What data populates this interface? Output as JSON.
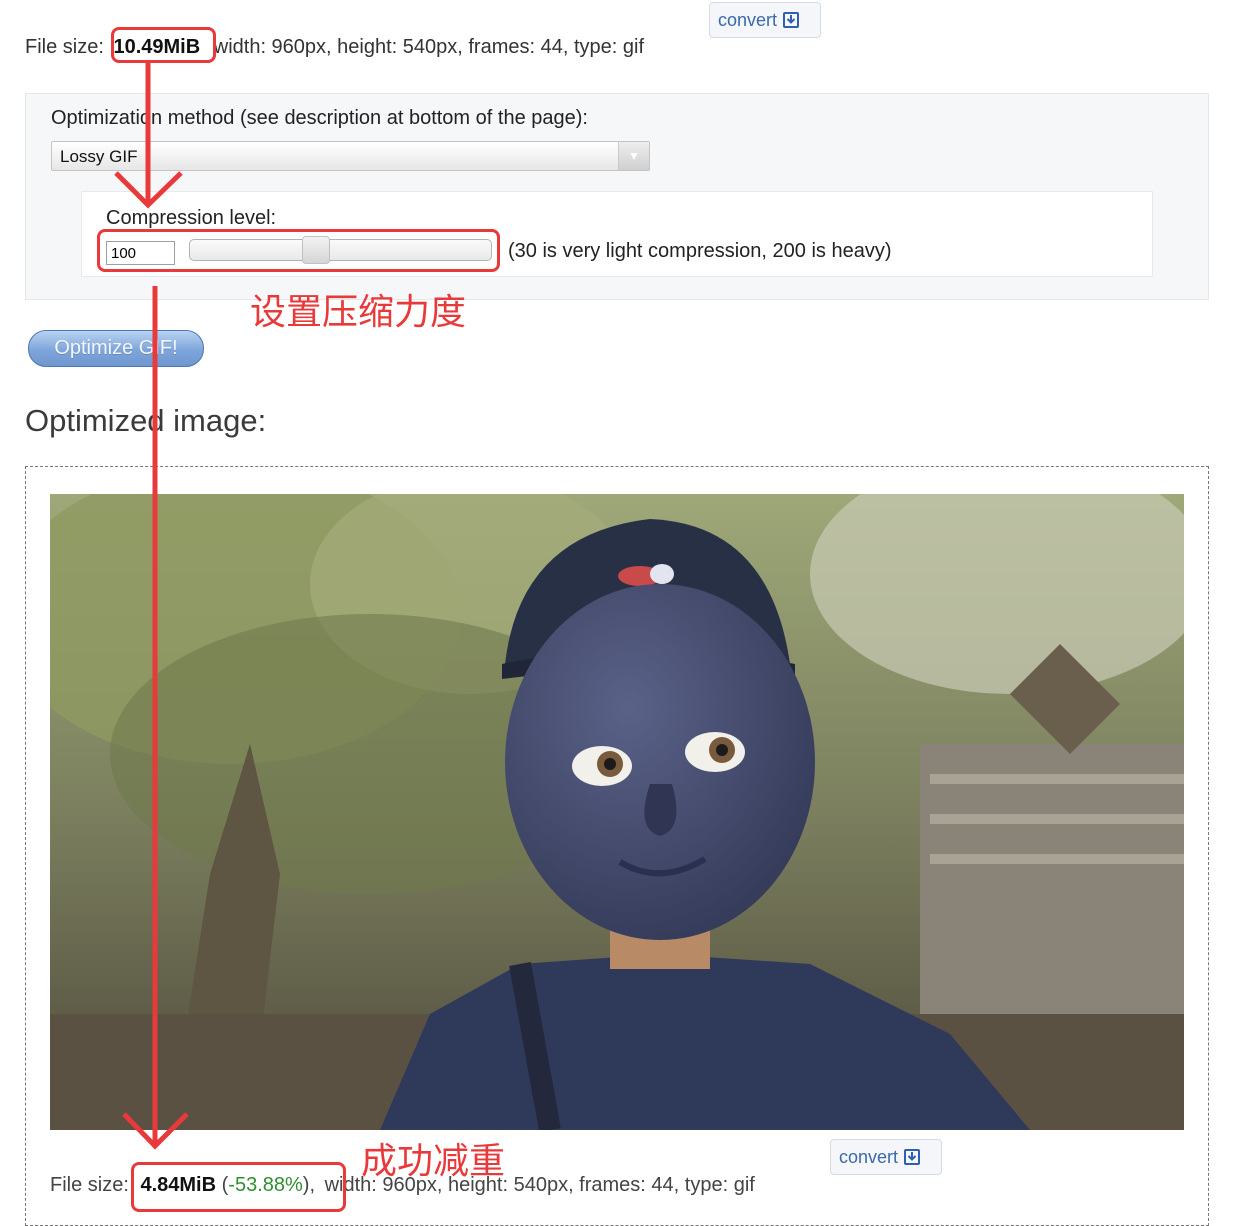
{
  "original": {
    "file_size_label": "File size:",
    "file_size_value": "10.49MiB",
    "details": "width: 960px, height: 540px, frames: 44, type: gif",
    "convert_label": "convert"
  },
  "options": {
    "method_label": "Optimization method (see description at bottom of the page):",
    "method_selected": "Lossy GIF",
    "compression_label": "Compression level:",
    "compression_value": "100",
    "compression_level": 100,
    "compression_min": 30,
    "compression_max": 200,
    "compression_hint": "(30 is very light compression, 200 is heavy)",
    "submit_label": "Optimize GIF!"
  },
  "result": {
    "heading": "Optimized image:",
    "file_size_label": "File size:",
    "file_size_value": "4.84MiB",
    "change_open": " (",
    "change_percent": "-53.88%",
    "change_close": "),",
    "details": "width: 960px, height: 540px, frames: 44, type: gif",
    "convert_label": "convert"
  },
  "annotations": {
    "compression_note": "设置压缩力度",
    "success_note": "成功减重"
  },
  "colors": {
    "annotation_red": "#e8393b",
    "reduction_green": "#2f8f2f",
    "link_blue": "#3a6aa8",
    "face_blue": "#3e4566"
  }
}
